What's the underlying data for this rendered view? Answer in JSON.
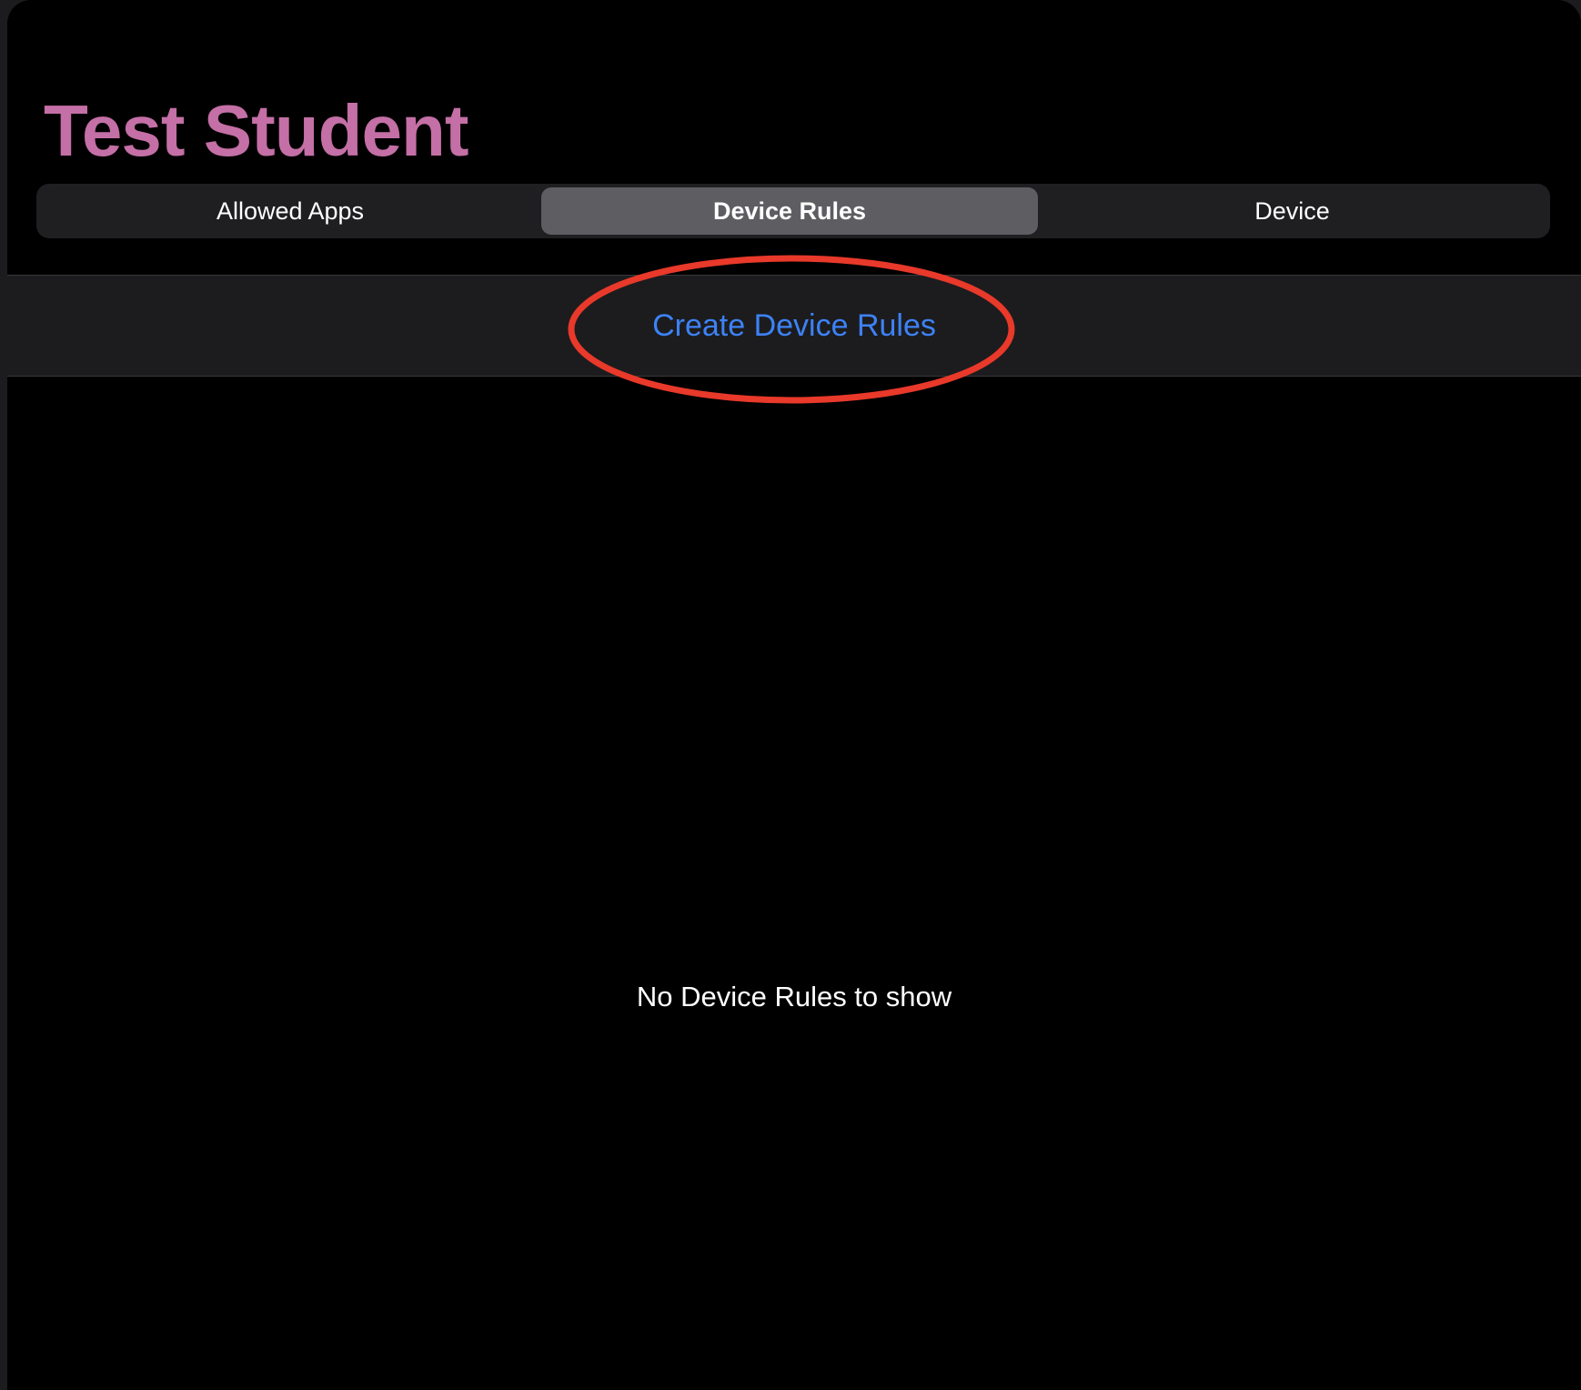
{
  "student": {
    "name": "Test Student"
  },
  "tabs": [
    {
      "label": "Allowed Apps",
      "selected": false
    },
    {
      "label": "Device Rules",
      "selected": true
    },
    {
      "label": "Device",
      "selected": false
    }
  ],
  "actions": {
    "create_label": "Create Device Rules"
  },
  "empty_state": {
    "message": "No Device Rules to show"
  },
  "colors": {
    "title": "#c46fa6",
    "link": "#3d82f5",
    "annotation": "#e8392a",
    "selected_segment": "#5d5d62"
  }
}
